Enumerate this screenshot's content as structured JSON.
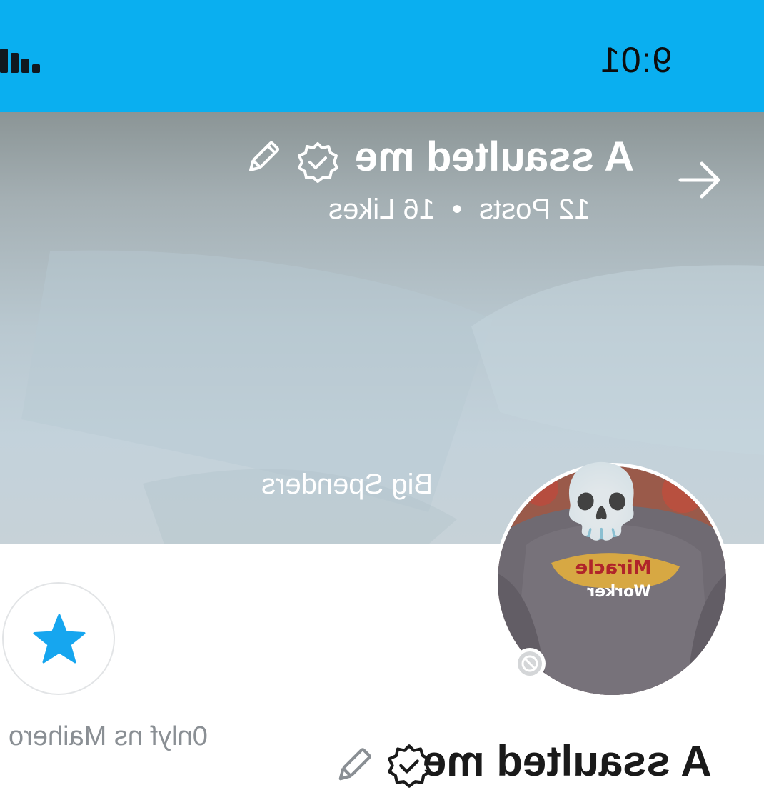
{
  "status_bar": {
    "time": "9:01",
    "signal_icon": "signal-bars-icon",
    "background": "#0aaff0"
  },
  "header": {
    "title": "A ssaulted me",
    "stats": {
      "posts": "12 Posts",
      "separator": "•",
      "likes": "16 Likes"
    },
    "back_icon": "arrow-icon",
    "verified_icon": "verified-badge-icon",
    "edit_icon": "pencil-icon"
  },
  "cover": {
    "subtitle": "Big Spenders"
  },
  "profile": {
    "avatar_overlay_emoji": "💀",
    "avatar_shirt_text_1": "Miracle",
    "avatar_shirt_text_2": "Worker",
    "status_icon": "blocked-icon",
    "favorite_icon": "star-icon",
    "handle": "0nlyf ns Maihero",
    "display_name": "A ssaulted me"
  },
  "colors": {
    "accent": "#0aaff0",
    "star": "#16a6ef",
    "text_dark": "#1a1a1a",
    "text_muted": "#8a8f94"
  }
}
